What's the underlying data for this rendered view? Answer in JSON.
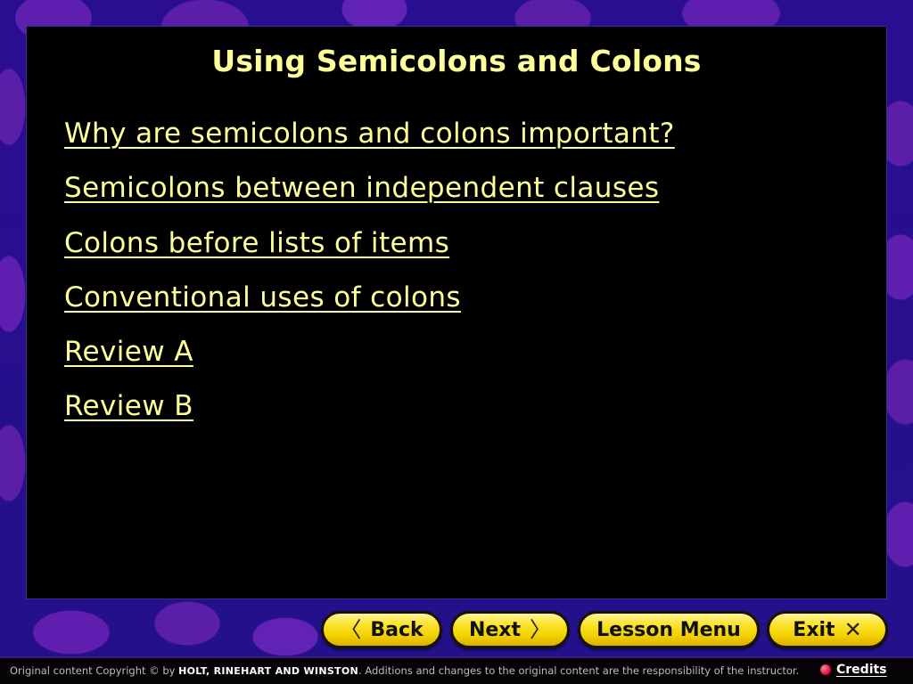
{
  "slide": {
    "title": "Using Semicolons and Colons",
    "links": [
      {
        "label": "Why are semicolons and colons important?"
      },
      {
        "label": "Semicolons between independent clauses"
      },
      {
        "label": "Colons before lists of items"
      },
      {
        "label": "Conventional uses of colons"
      },
      {
        "label": "Review A"
      },
      {
        "label": "Review B"
      }
    ]
  },
  "nav": {
    "back": {
      "label": "Back",
      "icon": "chevron-left-icon",
      "glyph": "〈"
    },
    "next": {
      "label": "Next",
      "icon": "chevron-right-icon",
      "glyph": "〉"
    },
    "lesson_menu": {
      "label": "Lesson Menu"
    },
    "exit": {
      "label": "Exit",
      "icon": "close-icon",
      "glyph": "✕"
    }
  },
  "footer": {
    "copyright_prefix": "Original content Copyright © by",
    "publisher": "HOLT, RINEHART AND WINSTON",
    "copyright_suffix": ". Additions and changes to the original content are the responsibility of the instructor.",
    "credits_label": "Credits"
  },
  "colors": {
    "text_accent": "#ffff99",
    "button_yellow": "#fbe32a",
    "background_purple": "#5e1fb0",
    "background_navy": "#1a0a7a"
  }
}
